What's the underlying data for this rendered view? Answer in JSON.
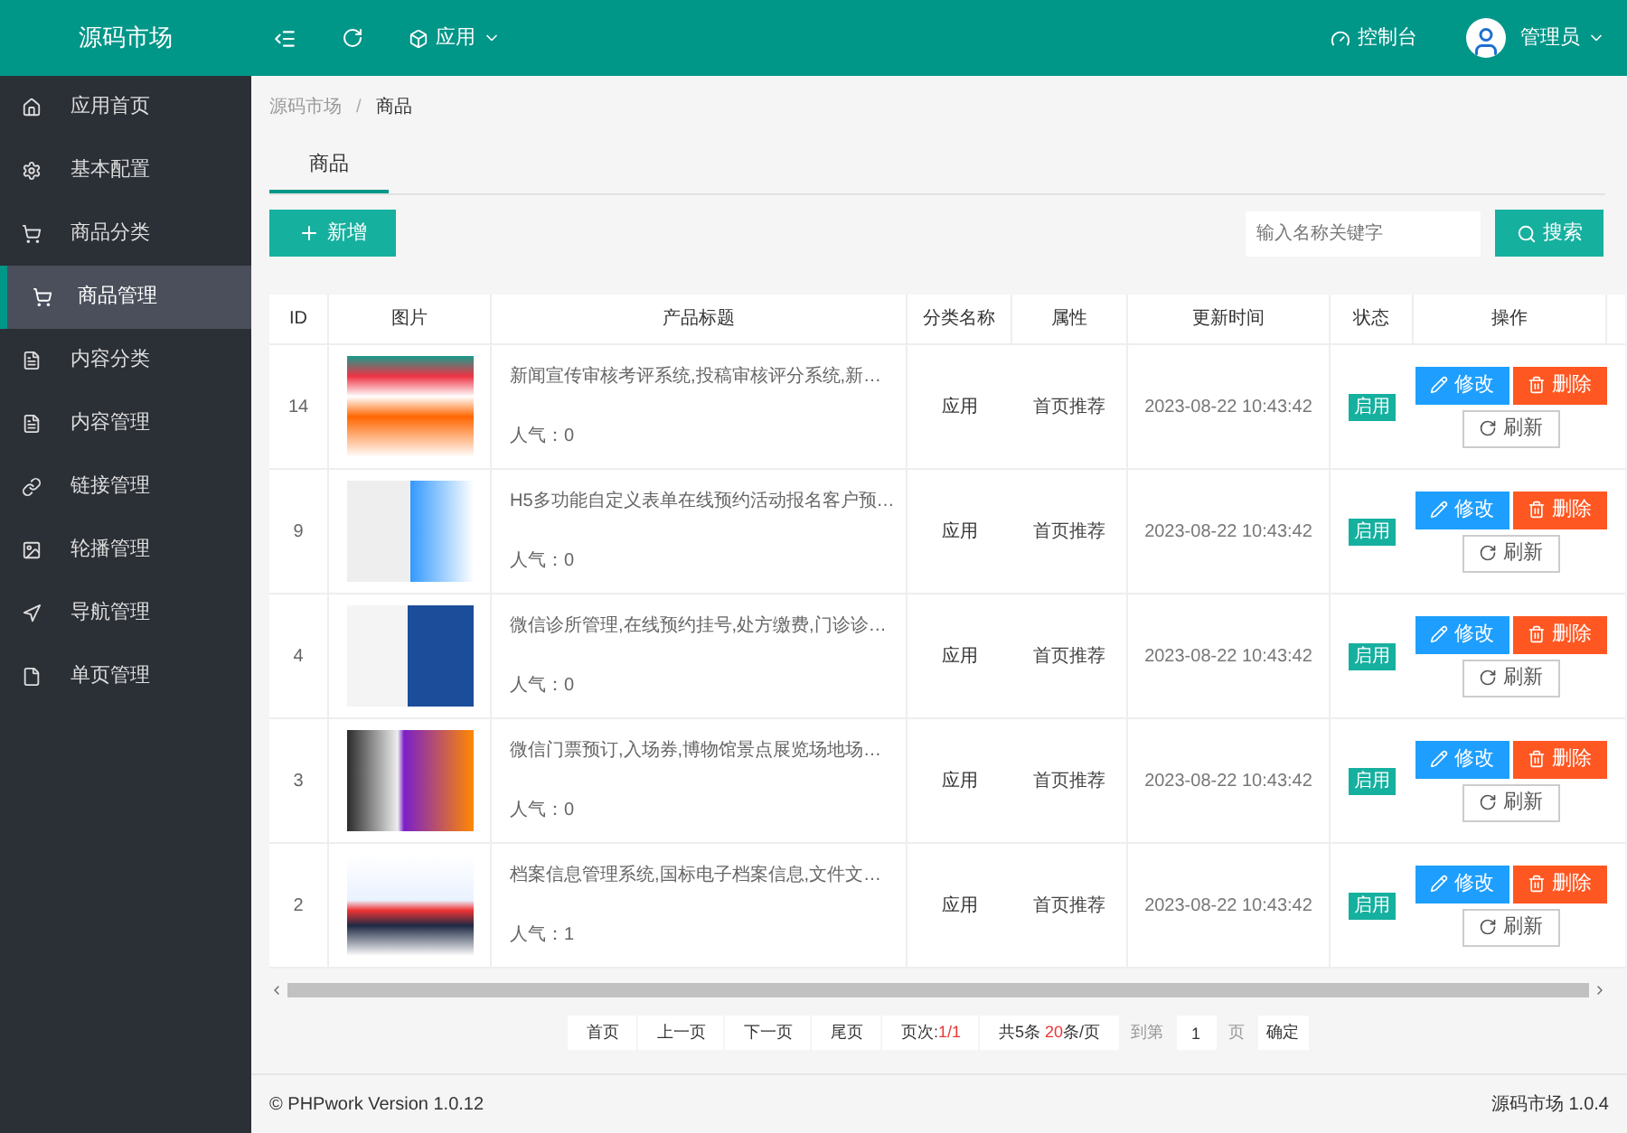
{
  "header": {
    "logo": "源码市场",
    "app_menu": "应用",
    "console": "控制台",
    "user": "管理员"
  },
  "sidebar": {
    "items": [
      {
        "label": "应用首页",
        "selected": false
      },
      {
        "label": "基本配置",
        "selected": false
      },
      {
        "label": "商品分类",
        "selected": false
      },
      {
        "label": "商品管理",
        "selected": true
      },
      {
        "label": "内容分类",
        "selected": false
      },
      {
        "label": "内容管理",
        "selected": false
      },
      {
        "label": "链接管理",
        "selected": false
      },
      {
        "label": "轮播管理",
        "selected": false
      },
      {
        "label": "导航管理",
        "selected": false
      },
      {
        "label": "单页管理",
        "selected": false
      }
    ]
  },
  "breadcrumb": {
    "items": [
      "源码市场",
      "商品"
    ],
    "separator": "/"
  },
  "tabs": [
    {
      "label": "商品",
      "selected": true
    }
  ],
  "toolbar": {
    "add_button": "新增",
    "search": {
      "placeholder": "输入名称关键字"
    },
    "search_button": "搜索"
  },
  "table": {
    "columns": [
      "ID",
      "图片",
      "产品标题",
      "分类名称",
      "属性",
      "更新时间",
      "状态",
      "操作"
    ],
    "rows": [
      {
        "id": "14",
        "title": "新闻宣传审核考评系统,投稿审核评分系统,新…",
        "popularity": "人气：0",
        "category": "应用",
        "attribute": "首页推荐",
        "updated": "2023-08-22 10:43:42",
        "status": {
          "label": "启用",
          "enabled": true
        },
        "actions": [
          {
            "kind": "edit",
            "label": "修改"
          },
          {
            "kind": "delete",
            "label": "删除"
          },
          {
            "kind": "refresh",
            "label": "刷新"
          }
        ]
      },
      {
        "id": "9",
        "title": "H5多功能自定义表单在线预约活动报名客户预…",
        "popularity": "人气：0",
        "category": "应用",
        "attribute": "首页推荐",
        "updated": "2023-08-22 10:43:42",
        "status": {
          "label": "启用",
          "enabled": true
        },
        "actions": [
          {
            "kind": "edit",
            "label": "修改"
          },
          {
            "kind": "delete",
            "label": "删除"
          },
          {
            "kind": "refresh",
            "label": "刷新"
          }
        ]
      },
      {
        "id": "4",
        "title": "微信诊所管理,在线预约挂号,处方缴费,门诊诊…",
        "popularity": "人气：0",
        "category": "应用",
        "attribute": "首页推荐",
        "updated": "2023-08-22 10:43:42",
        "status": {
          "label": "启用",
          "enabled": true
        },
        "actions": [
          {
            "kind": "edit",
            "label": "修改"
          },
          {
            "kind": "delete",
            "label": "删除"
          },
          {
            "kind": "refresh",
            "label": "刷新"
          }
        ]
      },
      {
        "id": "3",
        "title": "微信门票预订,入场券,博物馆景点展览场地场…",
        "popularity": "人气：0",
        "category": "应用",
        "attribute": "首页推荐",
        "updated": "2023-08-22 10:43:42",
        "status": {
          "label": "启用",
          "enabled": true
        },
        "actions": [
          {
            "kind": "edit",
            "label": "修改"
          },
          {
            "kind": "delete",
            "label": "删除"
          },
          {
            "kind": "refresh",
            "label": "刷新"
          }
        ]
      },
      {
        "id": "2",
        "title": "档案信息管理系统,国标电子档案信息,文件文…",
        "popularity": "人气：1",
        "category": "应用",
        "attribute": "首页推荐",
        "updated": "2023-08-22 10:43:42",
        "status": {
          "label": "启用",
          "enabled": true
        },
        "actions": [
          {
            "kind": "edit",
            "label": "修改"
          },
          {
            "kind": "delete",
            "label": "删除"
          },
          {
            "kind": "refresh",
            "label": "刷新"
          }
        ]
      }
    ]
  },
  "pagination": {
    "first": "首页",
    "prev": "上一页",
    "next": "下一页",
    "last": "尾页",
    "page_label": "页次:",
    "page_value": "1/1",
    "total": "共5条",
    "per_page_value": "20",
    "per_page_unit": "条/页",
    "goto_label": "到第",
    "goto_value": "1",
    "goto_unit": "页",
    "confirm": "确定"
  },
  "footer": {
    "left": "© PHPwork Version 1.0.12",
    "right": "源码市场 1.0.4"
  }
}
